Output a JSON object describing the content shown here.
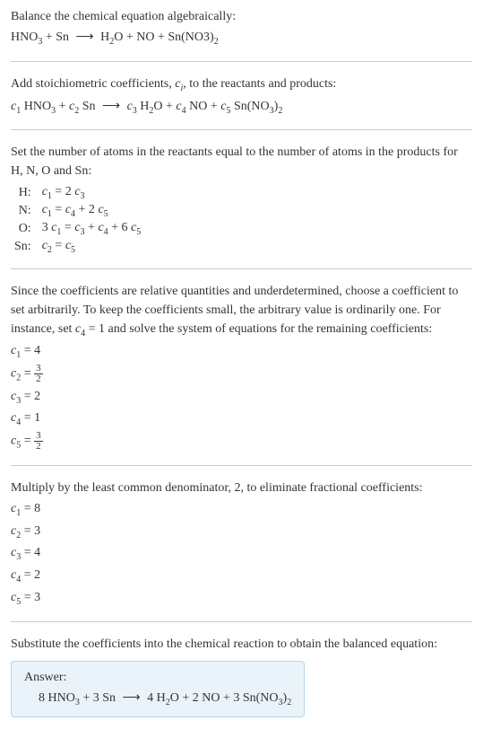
{
  "intro": {
    "line1": "Balance the chemical equation algebraically:",
    "eq_lhs1": "HNO",
    "eq_lhs1_sub": "3",
    "eq_plus1": " + Sn ",
    "eq_arrow": "⟶",
    "eq_rhs1": " H",
    "eq_rhs1_sub": "2",
    "eq_rhs2": "O + NO + Sn(NO3)",
    "eq_rhs2_sub": "2"
  },
  "stoich": {
    "line1a": "Add stoichiometric coefficients, ",
    "ci": "c",
    "ci_sub": "i",
    "line1b": ", to the reactants and products:",
    "c1": "c",
    "c1sub": "1",
    "sp1": " HNO",
    "sp1sub": "3",
    "plus1": " + ",
    "c2": "c",
    "c2sub": "2",
    "sp2": " Sn ",
    "arrow": "⟶",
    "sp3a": " ",
    "c3": "c",
    "c3sub": "3",
    "sp3": " H",
    "sp3sub": "2",
    "sp3b": "O + ",
    "c4": "c",
    "c4sub": "4",
    "sp4": " NO + ",
    "c5": "c",
    "c5sub": "5",
    "sp5": " Sn(NO",
    "sp5sub": "3",
    "sp5b": ")",
    "sp5sub2": "2"
  },
  "atoms": {
    "intro": "Set the number of atoms in the reactants equal to the number of atoms in the products for H, N, O and Sn:",
    "rows": [
      {
        "label": "H:",
        "c_l": "c",
        "c_ls": "1",
        "mid": " = 2 ",
        "c_r": "c",
        "c_rs": "3",
        "extra": ""
      },
      {
        "label": "N:",
        "c_l": "c",
        "c_ls": "1",
        "mid": " = ",
        "c_r": "c",
        "c_rs": "4",
        "extra_a": " + 2 ",
        "extra_c": "c",
        "extra_cs": "5"
      },
      {
        "label": "O:",
        "pre": "3 ",
        "c_l": "c",
        "c_ls": "1",
        "mid": " = ",
        "c_r": "c",
        "c_rs": "3",
        "extra_a": " + ",
        "extra_c": "c",
        "extra_cs": "4",
        "extra_b": " + 6 ",
        "extra_d": "c",
        "extra_ds": "5"
      },
      {
        "label": "Sn:",
        "c_l": "c",
        "c_ls": "2",
        "mid": " = ",
        "c_r": "c",
        "c_rs": "5",
        "extra": ""
      }
    ]
  },
  "choice": {
    "text_a": "Since the coefficients are relative quantities and underdetermined, choose a coefficient to set arbitrarily. To keep the coefficients small, the arbitrary value is ordinarily one. For instance, set ",
    "c4": "c",
    "c4sub": "4",
    "text_b": " = 1 and solve the system of equations for the remaining coefficients:",
    "r1_c": "c",
    "r1_s": "1",
    "r1_v": " = 4",
    "r2_c": "c",
    "r2_s": "2",
    "r2_eq": " = ",
    "r2_num": "3",
    "r2_den": "2",
    "r3_c": "c",
    "r3_s": "3",
    "r3_v": " = 2",
    "r4_c": "c",
    "r4_s": "4",
    "r4_v": " = 1",
    "r5_c": "c",
    "r5_s": "5",
    "r5_eq": " = ",
    "r5_num": "3",
    "r5_den": "2"
  },
  "mult": {
    "text": "Multiply by the least common denominator, 2, to eliminate fractional coefficients:",
    "r1_c": "c",
    "r1_s": "1",
    "r1_v": " = 8",
    "r2_c": "c",
    "r2_s": "2",
    "r2_v": " = 3",
    "r3_c": "c",
    "r3_s": "3",
    "r3_v": " = 4",
    "r4_c": "c",
    "r4_s": "4",
    "r4_v": " = 2",
    "r5_c": "c",
    "r5_s": "5",
    "r5_v": " = 3"
  },
  "final": {
    "text": "Substitute the coefficients into the chemical reaction to obtain the balanced equation:",
    "answer_label": "Answer:",
    "eq_a": "8 HNO",
    "eq_a_sub": "3",
    "eq_b": " + 3 Sn ",
    "eq_arrow": "⟶",
    "eq_c": " 4 H",
    "eq_c_sub": "2",
    "eq_d": "O + 2 NO + 3 Sn(NO",
    "eq_d_sub": "3",
    "eq_e": ")",
    "eq_e_sub": "2"
  }
}
